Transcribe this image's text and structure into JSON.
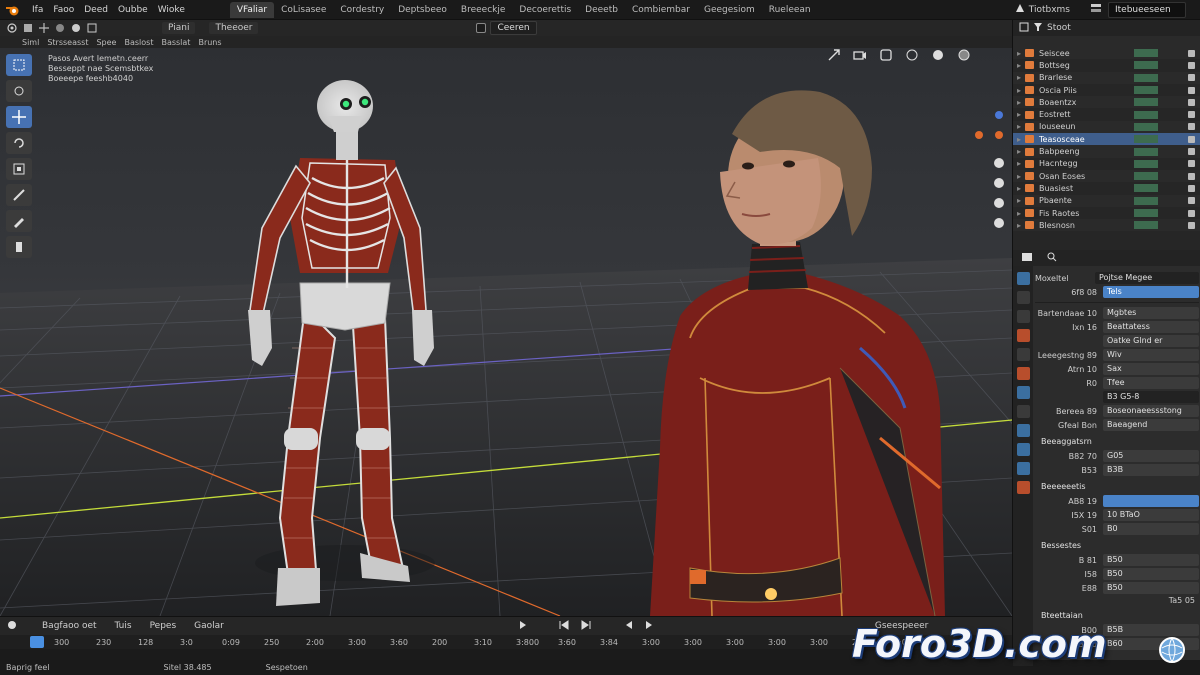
{
  "menubar": {
    "items": [
      "Ifa",
      "Faoo",
      "Deed",
      "Oubbe",
      "Wioke"
    ],
    "tabs": [
      "VFaliar",
      "CoLisasee",
      "Cordestry",
      "Deptsbeeo",
      "Breeeckje",
      "Decoerettis",
      "Deeetb",
      "Combiembar",
      "Geegesiom",
      "Rueleean"
    ],
    "active_tab": "VFaliar",
    "scene_label": "Tiotbxms",
    "view_layer": "Itebueeseen"
  },
  "viewport_header": {
    "mode": "Piani",
    "view": "Theeoer",
    "camera_select": "Ceeren"
  },
  "viewport_subheader": [
    "Siml",
    "Strsseasst",
    "Spee",
    "Baslost",
    "Basslat",
    "Bruns"
  ],
  "viewport_info": [
    "Pasos Avert Iemetn.ceerr",
    "Besseppt nae Scemsbtkex",
    "Boeeepe feeshb4040"
  ],
  "timeline": {
    "menus": [
      "Bagfaoo oet",
      "Tuis",
      "Pepes",
      "Gaolar"
    ],
    "ticks": [
      "300",
      "230",
      "128",
      "3:0",
      "0:09",
      "250",
      "2:00",
      "3:00",
      "3:60",
      "200",
      "3:10",
      "3:800",
      "3:60",
      "3:84",
      "3:00",
      "3:00",
      "3:00",
      "3:00",
      "3:00",
      "2:00",
      "3:00"
    ],
    "playback_label": "Gseespeeer"
  },
  "statusbar": [
    "Baprig feel",
    "Sitel 38.485",
    "Sespetoen"
  ],
  "outliner": {
    "header": "Stoot",
    "items": [
      {
        "name": "Seiscee",
        "selected": false
      },
      {
        "name": "Bottseg",
        "selected": false
      },
      {
        "name": "Brarlese",
        "selected": false
      },
      {
        "name": "Oscia Piis",
        "selected": false
      },
      {
        "name": "Boaentzx",
        "selected": false
      },
      {
        "name": "Eostrett",
        "selected": false
      },
      {
        "name": "Iouseeun",
        "selected": false
      },
      {
        "name": "Teasosceae",
        "selected": true
      },
      {
        "name": "Babpeeng",
        "selected": false
      },
      {
        "name": "Hacntegg",
        "selected": false
      },
      {
        "name": "Osan Eoses",
        "selected": false
      },
      {
        "name": "Buasiest",
        "selected": false
      },
      {
        "name": "Pbaente",
        "selected": false
      },
      {
        "name": "Fis Raotes",
        "selected": false
      },
      {
        "name": "Blesnosn",
        "selected": false
      }
    ]
  },
  "properties": {
    "tabs_row": {
      "left": "Moxeltel",
      "right": "Pojtse Megee"
    },
    "top_field": {
      "label": "6f8 08",
      "value": "Tels"
    },
    "rows": [
      {
        "label": "Bartendaae 10",
        "value": "Mgbtes"
      },
      {
        "label": "Ixn 16",
        "value": "Beattatess"
      },
      {
        "label": "",
        "value": "Oatke Glnd er"
      },
      {
        "label": "Leeegestng 89",
        "value": "Wiv"
      },
      {
        "label": "Atrn 10",
        "value": "Sax"
      },
      {
        "label": "R0",
        "value": "Tfee"
      },
      {
        "label": "",
        "value": "B3 G5-8"
      },
      {
        "label": "Bereea 89",
        "value": "Boseonaeessstong"
      },
      {
        "label": "Gfeal Bon",
        "value": "Baeagend"
      }
    ],
    "section1": "Beeaggatsrn",
    "section1_rows": [
      {
        "label": "B82 70",
        "value": "G05"
      },
      {
        "label": "B53",
        "value": "B3B"
      }
    ],
    "section2": "Beeeeeetis",
    "section2_rows": [
      {
        "label": "AB8 19",
        "value": ""
      },
      {
        "label": "I5X 19",
        "value": "10 BTaO"
      },
      {
        "label": "S01",
        "value": "B0"
      }
    ],
    "section3": "Bessestes",
    "section3_rows": [
      {
        "label": "B 81",
        "value": "B50"
      },
      {
        "label": "I58",
        "value": "B50"
      },
      {
        "label": "E88",
        "value": "B50"
      }
    ],
    "section3_note": "Ta5 05",
    "section4": "Bteettaian",
    "section4_rows": [
      {
        "label": "B00",
        "value": "B5B"
      },
      {
        "label": "3.B0",
        "value": "B60"
      }
    ]
  },
  "watermark": "Foro3D.com",
  "colors": {
    "accent_blue": "#4772b3",
    "selection_blue": "#3f5e8c",
    "grid_x_axis": "#d0e840",
    "grid_y_axis": "#7060c8",
    "orange_edge": "#e06a2c"
  },
  "icons": [
    "blender-logo-icon",
    "move-tool-icon",
    "rotate-tool-icon",
    "scale-tool-icon",
    "cursor-tool-icon",
    "annotate-icon",
    "camera-icon",
    "scene-icon",
    "view-layer-icon",
    "eye-icon",
    "filter-icon"
  ]
}
